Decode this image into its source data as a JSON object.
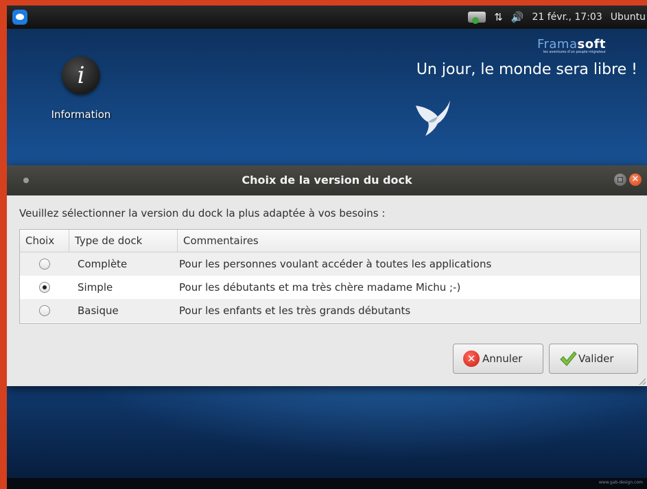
{
  "topbar": {
    "clock": "21 févr., 17:03",
    "hostname": "Ubuntu",
    "icons": [
      "xfce-menu-icon",
      "network-manager-icon",
      "updown-arrows-icon",
      "volume-icon"
    ],
    "arrows_glyph": "⇅",
    "volume_glyph": "🔊"
  },
  "desktop": {
    "icon_glyph": "i",
    "icon_label": "Information",
    "brand_prefix": "Frama",
    "brand_suffix": "soft",
    "brand_tagline": "les aventures d'un peuple migrateur",
    "slogan": "Un jour, le monde sera libre !"
  },
  "dialog": {
    "title": "Choix de la version du dock",
    "close_glyph": "✕",
    "prompt": "Veuillez sélectionner la version du dock la plus adaptée à vos besoins :",
    "columns": [
      "Choix",
      "Type de dock",
      "Commentaires"
    ],
    "rows": [
      {
        "selected": false,
        "type": "Complète",
        "comment": "Pour les personnes voulant accéder à toutes les applications"
      },
      {
        "selected": true,
        "type": "Simple",
        "comment": "Pour les débutants et ma très chère madame Michu ;-)"
      },
      {
        "selected": false,
        "type": "Basique",
        "comment": "Pour les enfants et les très grands débutants"
      }
    ],
    "cancel_label": "Annuler",
    "cancel_glyph": "✕",
    "ok_label": "Valider"
  },
  "footer": {
    "credits": "www.gab-design.com"
  },
  "colors": {
    "frame": "#d5401f",
    "accent_blue": "#1c5ea8",
    "close_orange": "#e0501f"
  }
}
